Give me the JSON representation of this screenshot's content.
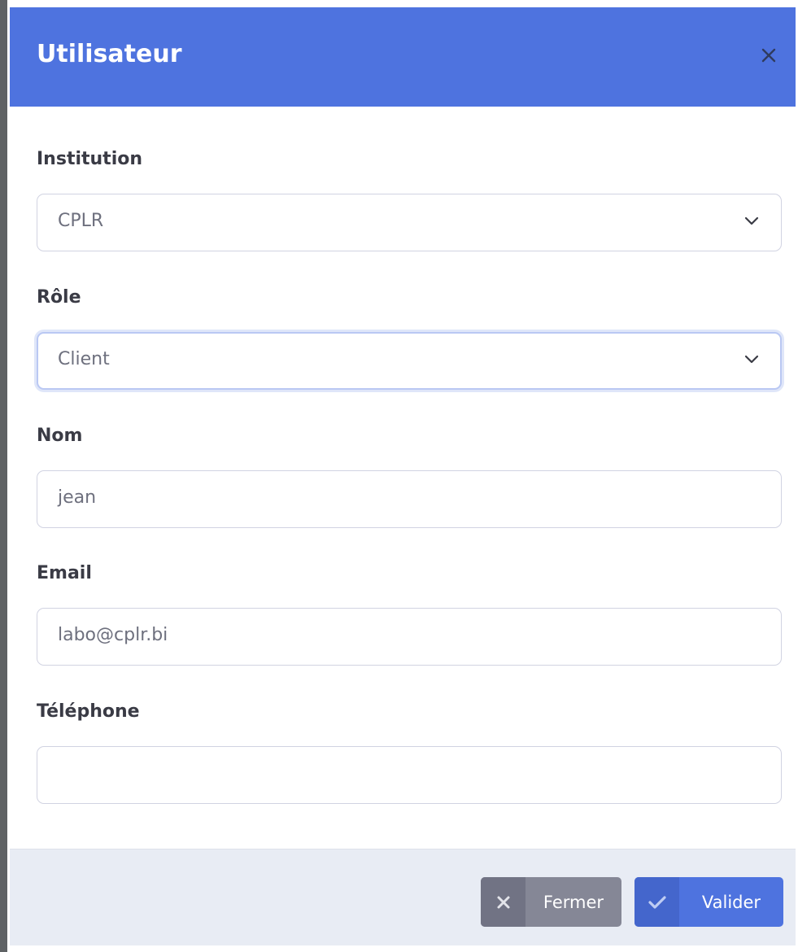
{
  "modal": {
    "title": "Utilisateur"
  },
  "fields": {
    "institution": {
      "label": "Institution",
      "value": "CPLR"
    },
    "role": {
      "label": "Rôle",
      "value": "Client"
    },
    "nom": {
      "label": "Nom",
      "value": "jean"
    },
    "email": {
      "label": "Email",
      "value": "labo@cplr.bi"
    },
    "telephone": {
      "label": "Téléphone",
      "value": ""
    }
  },
  "footer": {
    "close_label": "Fermer",
    "submit_label": "Valider"
  },
  "icons": {
    "close": "close-icon",
    "chevron": "chevron-down-icon",
    "times": "times-icon",
    "check": "check-icon"
  },
  "colors": {
    "primary": "#4e73df",
    "secondary": "#858796",
    "footer_bg": "#e8ecf4"
  }
}
